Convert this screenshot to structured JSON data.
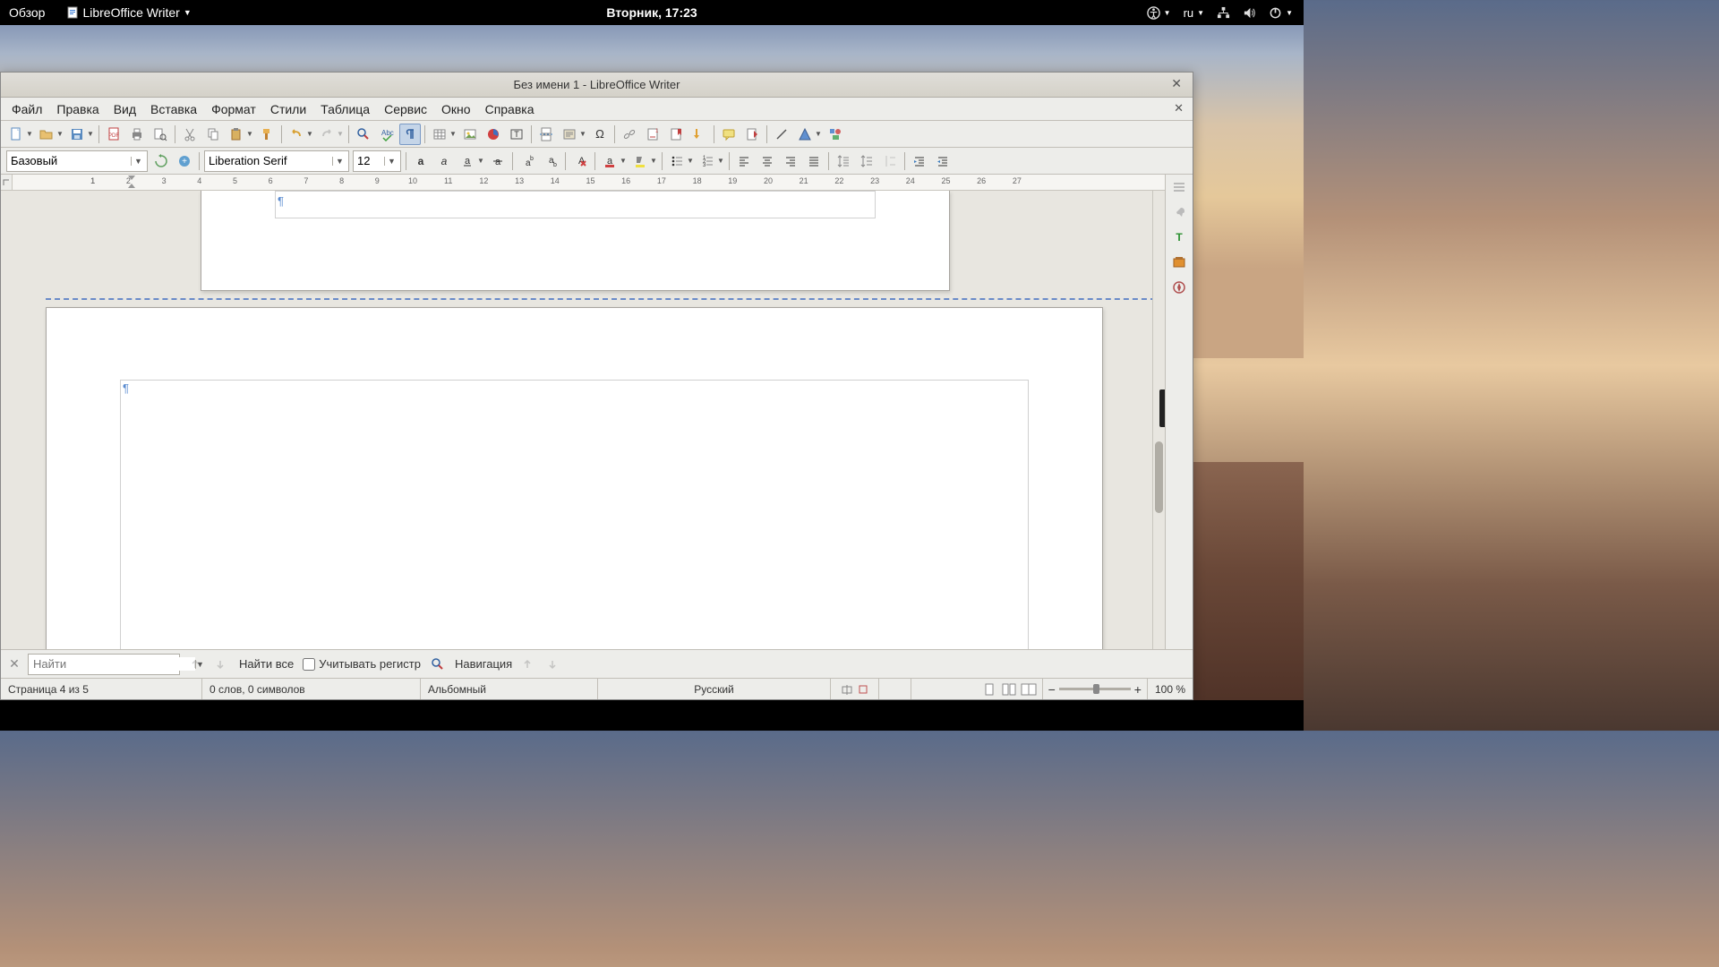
{
  "topbar": {
    "activities": "Обзор",
    "app_menu": "LibreOffice Writer",
    "clock": "Вторник, 17:23",
    "lang": "ru"
  },
  "window": {
    "title": "Без имени 1 - LibreOffice Writer"
  },
  "menubar": {
    "file": "Файл",
    "edit": "Правка",
    "view": "Вид",
    "insert": "Вставка",
    "format": "Формат",
    "styles": "Стили",
    "table": "Таблица",
    "tools": "Сервис",
    "window": "Окно",
    "help": "Справка"
  },
  "format_bar": {
    "paragraph_style": "Базовый",
    "font_name": "Liberation Serif",
    "font_size": "12"
  },
  "ruler": {
    "marks": [
      1,
      1,
      2,
      3,
      4,
      5,
      6,
      7,
      8,
      9,
      10,
      11,
      12,
      13,
      14,
      15,
      16,
      17,
      18,
      19,
      20,
      21,
      22,
      23,
      24,
      25,
      26,
      27
    ]
  },
  "findbar": {
    "placeholder": "Найти",
    "find_all": "Найти все",
    "match_case": "Учитывать регистр",
    "navigation": "Навигация"
  },
  "statusbar": {
    "page": "Страница 4 из 5",
    "words": "0 слов, 0 символов",
    "page_style": "Альбомный",
    "language": "Русский",
    "zoom": "100 %"
  }
}
